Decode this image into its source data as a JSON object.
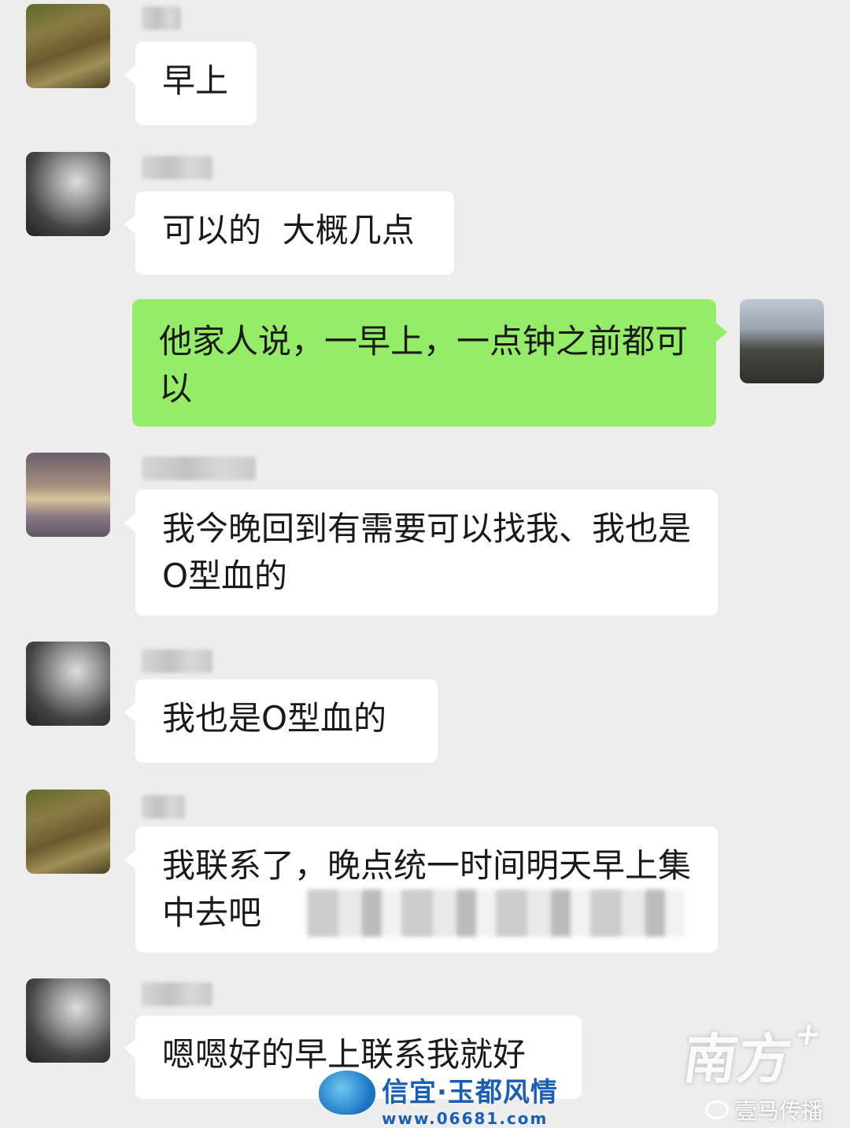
{
  "messages": [
    {
      "side": "left",
      "avatar": "nature-stream-avatar",
      "text": "早上"
    },
    {
      "side": "left",
      "avatar": "dark-figure-avatar",
      "text": "可以的  大概几点"
    },
    {
      "side": "right",
      "avatar": "self-portrait-avatar",
      "text": "他家人说，一早上，一点钟之前都可以"
    },
    {
      "side": "left",
      "avatar": "sparkling-water-avatar",
      "text": "我今晚回到有需要可以找我、我也是O型血的"
    },
    {
      "side": "left",
      "avatar": "dark-figure-avatar",
      "text": "我也是O型血的"
    },
    {
      "side": "left",
      "avatar": "nature-stream-avatar",
      "text_visible": "我联系了，晚点统一时间明天早上集中去吧"
    },
    {
      "side": "left",
      "avatar": "dark-figure-avatar",
      "text": "嗯嗯好的早上联系我就好"
    }
  ],
  "colors": {
    "background": "#ededed",
    "bubble_incoming": "#ffffff",
    "bubble_outgoing": "#95ec69"
  },
  "watermarks": {
    "south": "南方",
    "south_plus": "+",
    "wechat_account": "壹马传播",
    "site_name": "信宜·玉都风情",
    "site_url": "www.06681.com"
  }
}
